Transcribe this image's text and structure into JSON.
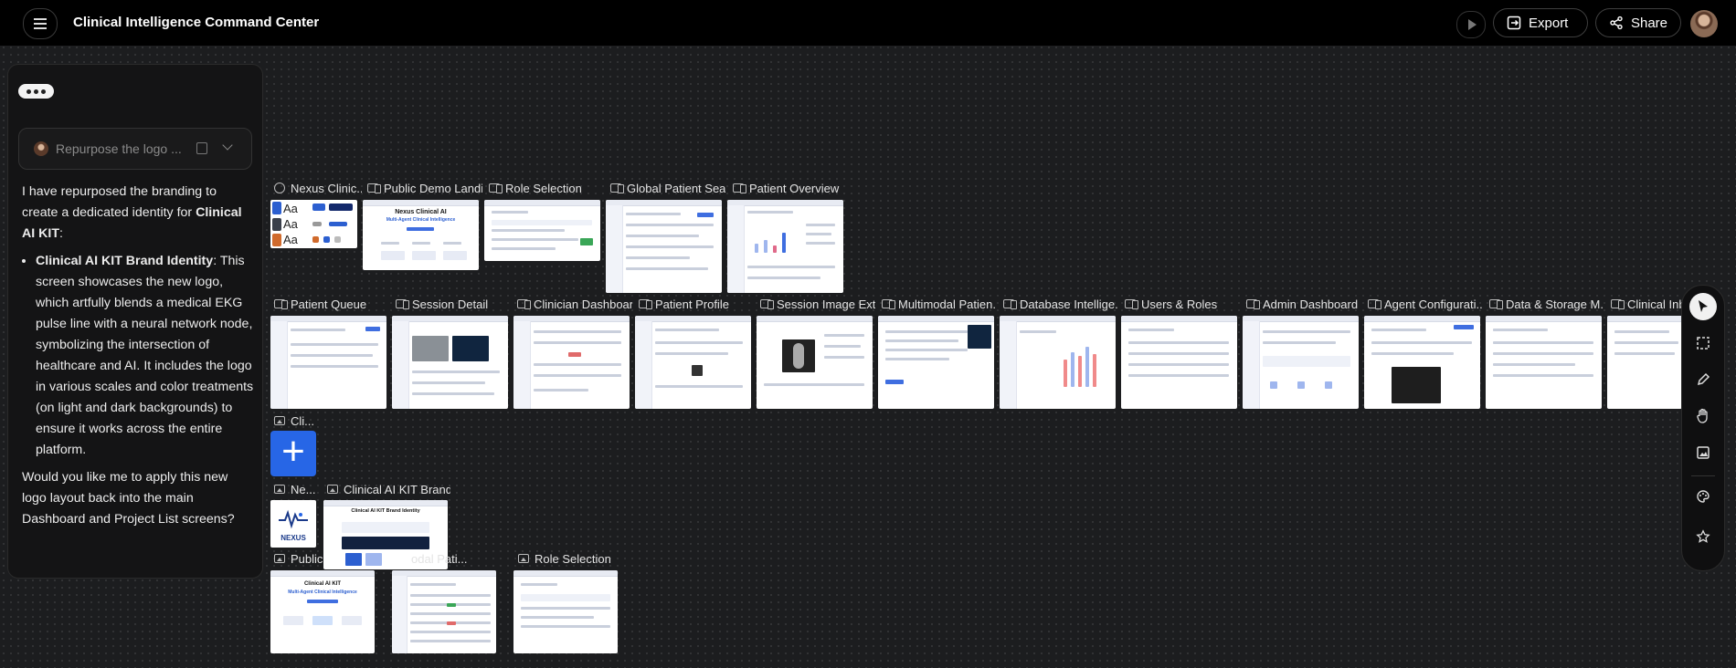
{
  "header": {
    "title": "Clinical Intelligence Command Center",
    "export_label": "Export",
    "share_label": "Share",
    "icons": [
      "menu-icon",
      "play-icon",
      "export-icon",
      "share-icon",
      "avatar"
    ]
  },
  "chat": {
    "prompt_text": "Repurpose the logo ...",
    "intro": "I have repurposed the branding to create a dedicated identity for",
    "intro_bold": "Clinical AI KIT",
    "intro_end": ":",
    "bullet_title": "Clinical AI KIT Brand Identity",
    "bullet_body": ": This screen showcases the new logo, which artfully blends a medical EKG pulse line with a neural network node, symbolizing the intersection of healthcare and AI. It includes the logo in various scales and color treatments (on light and dark backgrounds) to ensure it works across the entire platform.",
    "question": "Would you like me to apply this new logo layout back into the main Dashboard and Project List screens?"
  },
  "canvas": {
    "row1": [
      "Nexus Clinic...",
      "Public Demo Landi...",
      "Role Selection",
      "Global Patient Sea...",
      "Patient Overview"
    ],
    "row2": [
      "Patient Queue",
      "Session Detail",
      "Clinician Dashboard",
      "Patient Profile",
      "Session Image Ext...",
      "Multimodal Patien...",
      "Database Intellige...",
      "Users & Roles",
      "Admin Dashboard",
      "Agent Configurati...",
      "Data & Storage M...",
      "Clinical Inbo"
    ],
    "row3": [
      "Cli..."
    ],
    "row4": [
      "Ne...",
      "Clinical AI KIT Brand..."
    ],
    "row5": [
      "Public",
      "odal Pati...",
      "Role Selection"
    ],
    "landing_title": "Nexus Clinical AI",
    "landing_sub": "Multi-Agent Clinical Intelligence",
    "landing_title2": "Clinical AI KIT",
    "brand_heading": "Clinical AI KIT Brand Identity",
    "nexus_logo_text": "NEXUS",
    "type_sample": "Aa"
  },
  "colors": {
    "accent": "#2766e6",
    "canvas_bg": "#1c1d1f",
    "topbar_bg": "#000000"
  },
  "toolbar": {
    "tools": [
      "cursor-icon",
      "select-area-icon",
      "pen-icon",
      "hand-icon",
      "image-icon",
      "palette-icon",
      "star-icon"
    ],
    "active": "cursor-icon"
  }
}
